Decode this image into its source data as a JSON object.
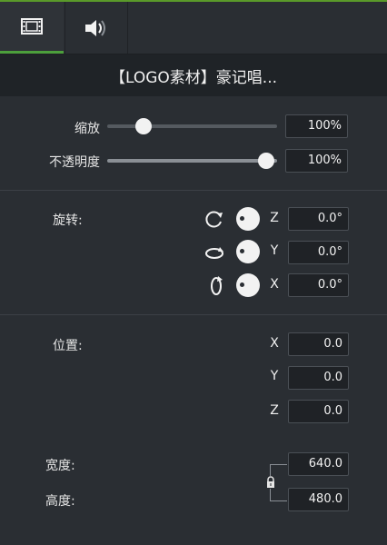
{
  "window": {
    "accent_color": "#4c9f3c"
  },
  "tabs": [
    {
      "name": "visual",
      "icon": "film-icon",
      "active": true
    },
    {
      "name": "audio",
      "icon": "speaker-icon",
      "active": false
    }
  ],
  "title": "【LOGO素材】豪记唱...",
  "scale": {
    "label": "缩放",
    "value": "100%",
    "slider_percent": 22
  },
  "opacity": {
    "label": "不透明度",
    "value": "100%",
    "slider_percent": 100
  },
  "rotation": {
    "label": "旋转:",
    "axes": [
      {
        "axis": "Z",
        "value": "0.0°",
        "icon": "rotate-z-icon"
      },
      {
        "axis": "Y",
        "value": "0.0°",
        "icon": "rotate-y-icon"
      },
      {
        "axis": "X",
        "value": "0.0°",
        "icon": "rotate-x-icon"
      }
    ]
  },
  "position": {
    "label": "位置:",
    "axes": [
      {
        "axis": "X",
        "value": "0.0"
      },
      {
        "axis": "Y",
        "value": "0.0"
      },
      {
        "axis": "Z",
        "value": "0.0"
      }
    ]
  },
  "size": {
    "width_label": "宽度:",
    "width_value": "640.0",
    "height_label": "高度:",
    "height_value": "480.0",
    "lock_icon": "lock-icon"
  }
}
